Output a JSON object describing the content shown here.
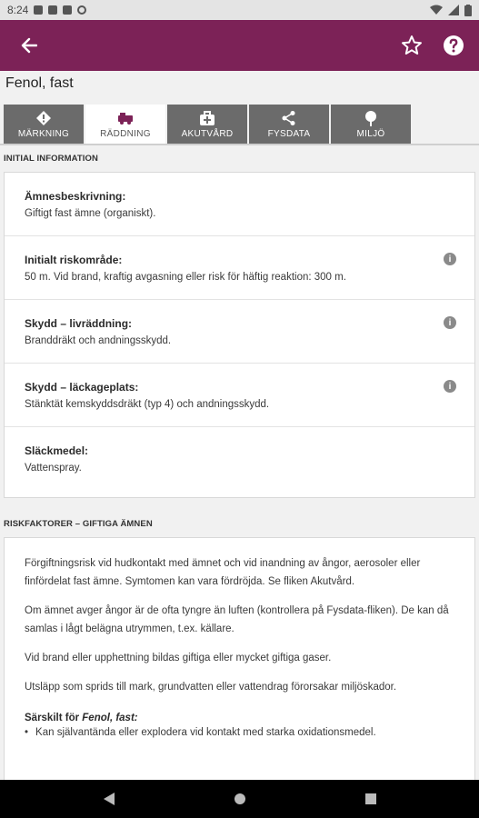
{
  "status_bar": {
    "time": "8:24"
  },
  "app_bar": {
    "back_icon": "arrow-left-icon",
    "favorite_icon": "star-outline-icon",
    "help_icon": "help-circle-icon"
  },
  "substance_title": "Fenol, fast",
  "tabs": [
    {
      "label": "MÄRKNING",
      "icon": "diamond-icon",
      "active": false
    },
    {
      "label": "RÄDDNING",
      "icon": "fire-truck-icon",
      "active": true
    },
    {
      "label": "AKUTVÅRD",
      "icon": "medkit-icon",
      "active": false
    },
    {
      "label": "FYSDATA",
      "icon": "share-nodes-icon",
      "active": false
    },
    {
      "label": "MILJÖ",
      "icon": "tree-icon",
      "active": false
    }
  ],
  "initial_section": {
    "heading": "INITIAL INFORMATION",
    "rows": [
      {
        "label": "Ämnesbeskrivning:",
        "value": "Giftigt fast ämne (organiskt)."
      },
      {
        "label": "Initialt riskområde:",
        "value": "50 m. Vid brand, kraftig avgasning eller risk för häftig reaktion: 300 m."
      },
      {
        "label": "Skydd – livräddning:",
        "value": "Branddräkt och andningsskydd."
      },
      {
        "label": "Skydd – läckageplats:",
        "value": "Stänktät kemskyddsdräkt (typ 4) och andningsskydd."
      },
      {
        "label": "Släckmedel:",
        "value": "Vattenspray."
      }
    ]
  },
  "risk_section": {
    "heading": "RISKFAKTORER – GIFTIGA ÄMNEN",
    "paragraphs": [
      "Förgiftningsrisk vid hudkontakt med ämnet och vid inandning av ångor, aerosoler eller finfördelat fast ämne. Symtomen kan vara fördröjda. Se fliken Akutvård.",
      "Om ämnet avger ångor är de ofta tyngre än luften (kontrollera på Fysdata-fliken). De kan då samlas i lågt belägna utrymmen, t.ex. källare.",
      "Vid brand eller upphettning bildas giftiga eller mycket giftiga gaser.",
      "Utsläpp som sprids till mark, grundvatten eller vattendrag förorsakar miljöskador."
    ],
    "special_prefix": "Särskilt för ",
    "special_substance": "Fenol, fast:",
    "bullets": [
      "Kan självantända eller explodera vid kontakt med starka oxidationsmedel."
    ]
  },
  "colors": {
    "appbar": "#7c2257",
    "tab_inactive": "#6b6b6b",
    "tab_active": "#ffffff"
  }
}
